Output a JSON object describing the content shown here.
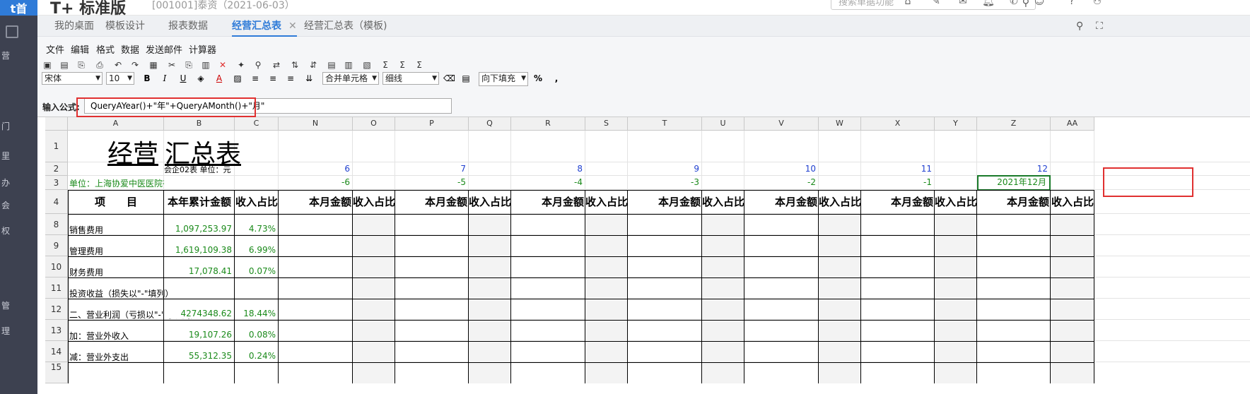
{
  "app": {
    "logo": "t首",
    "title": "T+ 标准版",
    "account_info": "[001001]泰资（2021-06-03）",
    "search_placeholder": "搜索单据功能",
    "left_nav_chars": [
      "营",
      "门",
      "里",
      "办",
      "会",
      "权",
      "管",
      "理"
    ]
  },
  "tabs": [
    {
      "label": "我的桌面",
      "active": false
    },
    {
      "label": "模板设计",
      "active": false
    },
    {
      "label": "报表数据",
      "active": false
    },
    {
      "label": "经营汇总表",
      "active": true
    },
    {
      "label": "经营汇总表（模板)",
      "active": false
    }
  ],
  "menu": [
    "文件",
    "编辑",
    "格式",
    "数据",
    "发送邮件",
    "计算器"
  ],
  "toolbar": {
    "font_name": "宋体",
    "font_size": "10",
    "merge_label": "合并单元格",
    "border_label": "细线",
    "fill_label": "向下填充",
    "percent_label": "%",
    "comma_label": ","
  },
  "formula_bar": {
    "label": "输入公式:",
    "value": "QueryAYear()+\"年\"+QueryAMonth()+\"月\""
  },
  "columns": [
    "A",
    "B",
    "C",
    "N",
    "O",
    "P",
    "Q",
    "R",
    "S",
    "T",
    "U",
    "V",
    "W",
    "X",
    "Y",
    "Z",
    "AA"
  ],
  "rows": [
    "1",
    "2",
    "3",
    "4",
    "8",
    "9",
    "10",
    "11",
    "12",
    "13",
    "14"
  ],
  "sheet": {
    "title_part1": "经营",
    "title_part2": "汇总表",
    "unit_row2": "会企02表 单位：元",
    "unit_row3": "单位：上海协爱中医医院有限公司",
    "header_item": "项　　目",
    "header_ytd": "本年累计金额",
    "header_ratio": "收入占比",
    "header_month": "本月金额",
    "months": [
      "6",
      "7",
      "8",
      "9",
      "10",
      "11",
      "12"
    ],
    "offsets": [
      "-6",
      "-5",
      "-4",
      "-3",
      "-2",
      "-1"
    ],
    "selected_cell": "2021年12月",
    "data_rows": [
      {
        "row": "8",
        "item": "销售费用",
        "ytd": "1,097,253.97",
        "ratio": "4.73%"
      },
      {
        "row": "9",
        "item": "管理费用",
        "ytd": "1,619,109.38",
        "ratio": "6.99%"
      },
      {
        "row": "10",
        "item": "财务费用",
        "ytd": "17,078.41",
        "ratio": "0.07%"
      },
      {
        "row": "11",
        "item": "投资收益（损失以\"-\"填列）",
        "ytd": "",
        "ratio": ""
      },
      {
        "row": "12",
        "item": "二、营业利润（亏损以\"-\"号填列）",
        "ytd": "4274348.62",
        "ratio": "18.44%"
      },
      {
        "row": "13",
        "item": "加：营业外收入",
        "ytd": "19,107.26",
        "ratio": "0.08%"
      },
      {
        "row": "14",
        "item": "减：营业外支出",
        "ytd": "55,312.35",
        "ratio": "0.24%"
      }
    ]
  },
  "colors": {
    "nav_bg": "#3d4150",
    "accent": "#2f7bd8",
    "highlight_red": "#e03030",
    "value_green": "#1a8a1a",
    "value_blue": "#1f3fd0"
  }
}
